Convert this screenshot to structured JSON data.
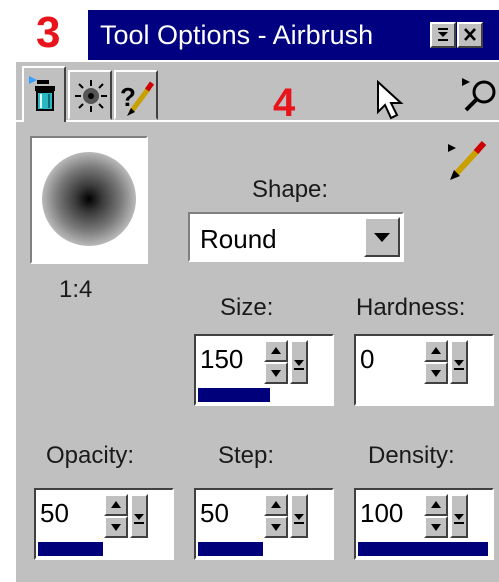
{
  "callouts": {
    "left": "3",
    "right": "4"
  },
  "window": {
    "title": "Tool Options - Airbrush"
  },
  "tabs": [
    {
      "icon": "airbrush-tool-icon",
      "active": true
    },
    {
      "icon": "brush-tip-icon",
      "active": false
    },
    {
      "icon": "help-brush-icon",
      "active": false
    }
  ],
  "preview": {
    "ratio": "1:4"
  },
  "shape": {
    "label": "Shape:",
    "value": "Round"
  },
  "size": {
    "label": "Size:",
    "value": "150",
    "level": 0.55
  },
  "hardness": {
    "label": "Hardness:",
    "value": "0",
    "level": 0
  },
  "opacity": {
    "label": "Opacity:",
    "value": "50",
    "level": 0.5
  },
  "step": {
    "label": "Step:",
    "value": "50",
    "level": 0.5
  },
  "density": {
    "label": "Density:",
    "value": "100",
    "level": 1
  },
  "colors": {
    "titlebar": "#000080",
    "panel": "#c0c0c0",
    "callout": "#e8141b",
    "fill": "#00007b"
  }
}
